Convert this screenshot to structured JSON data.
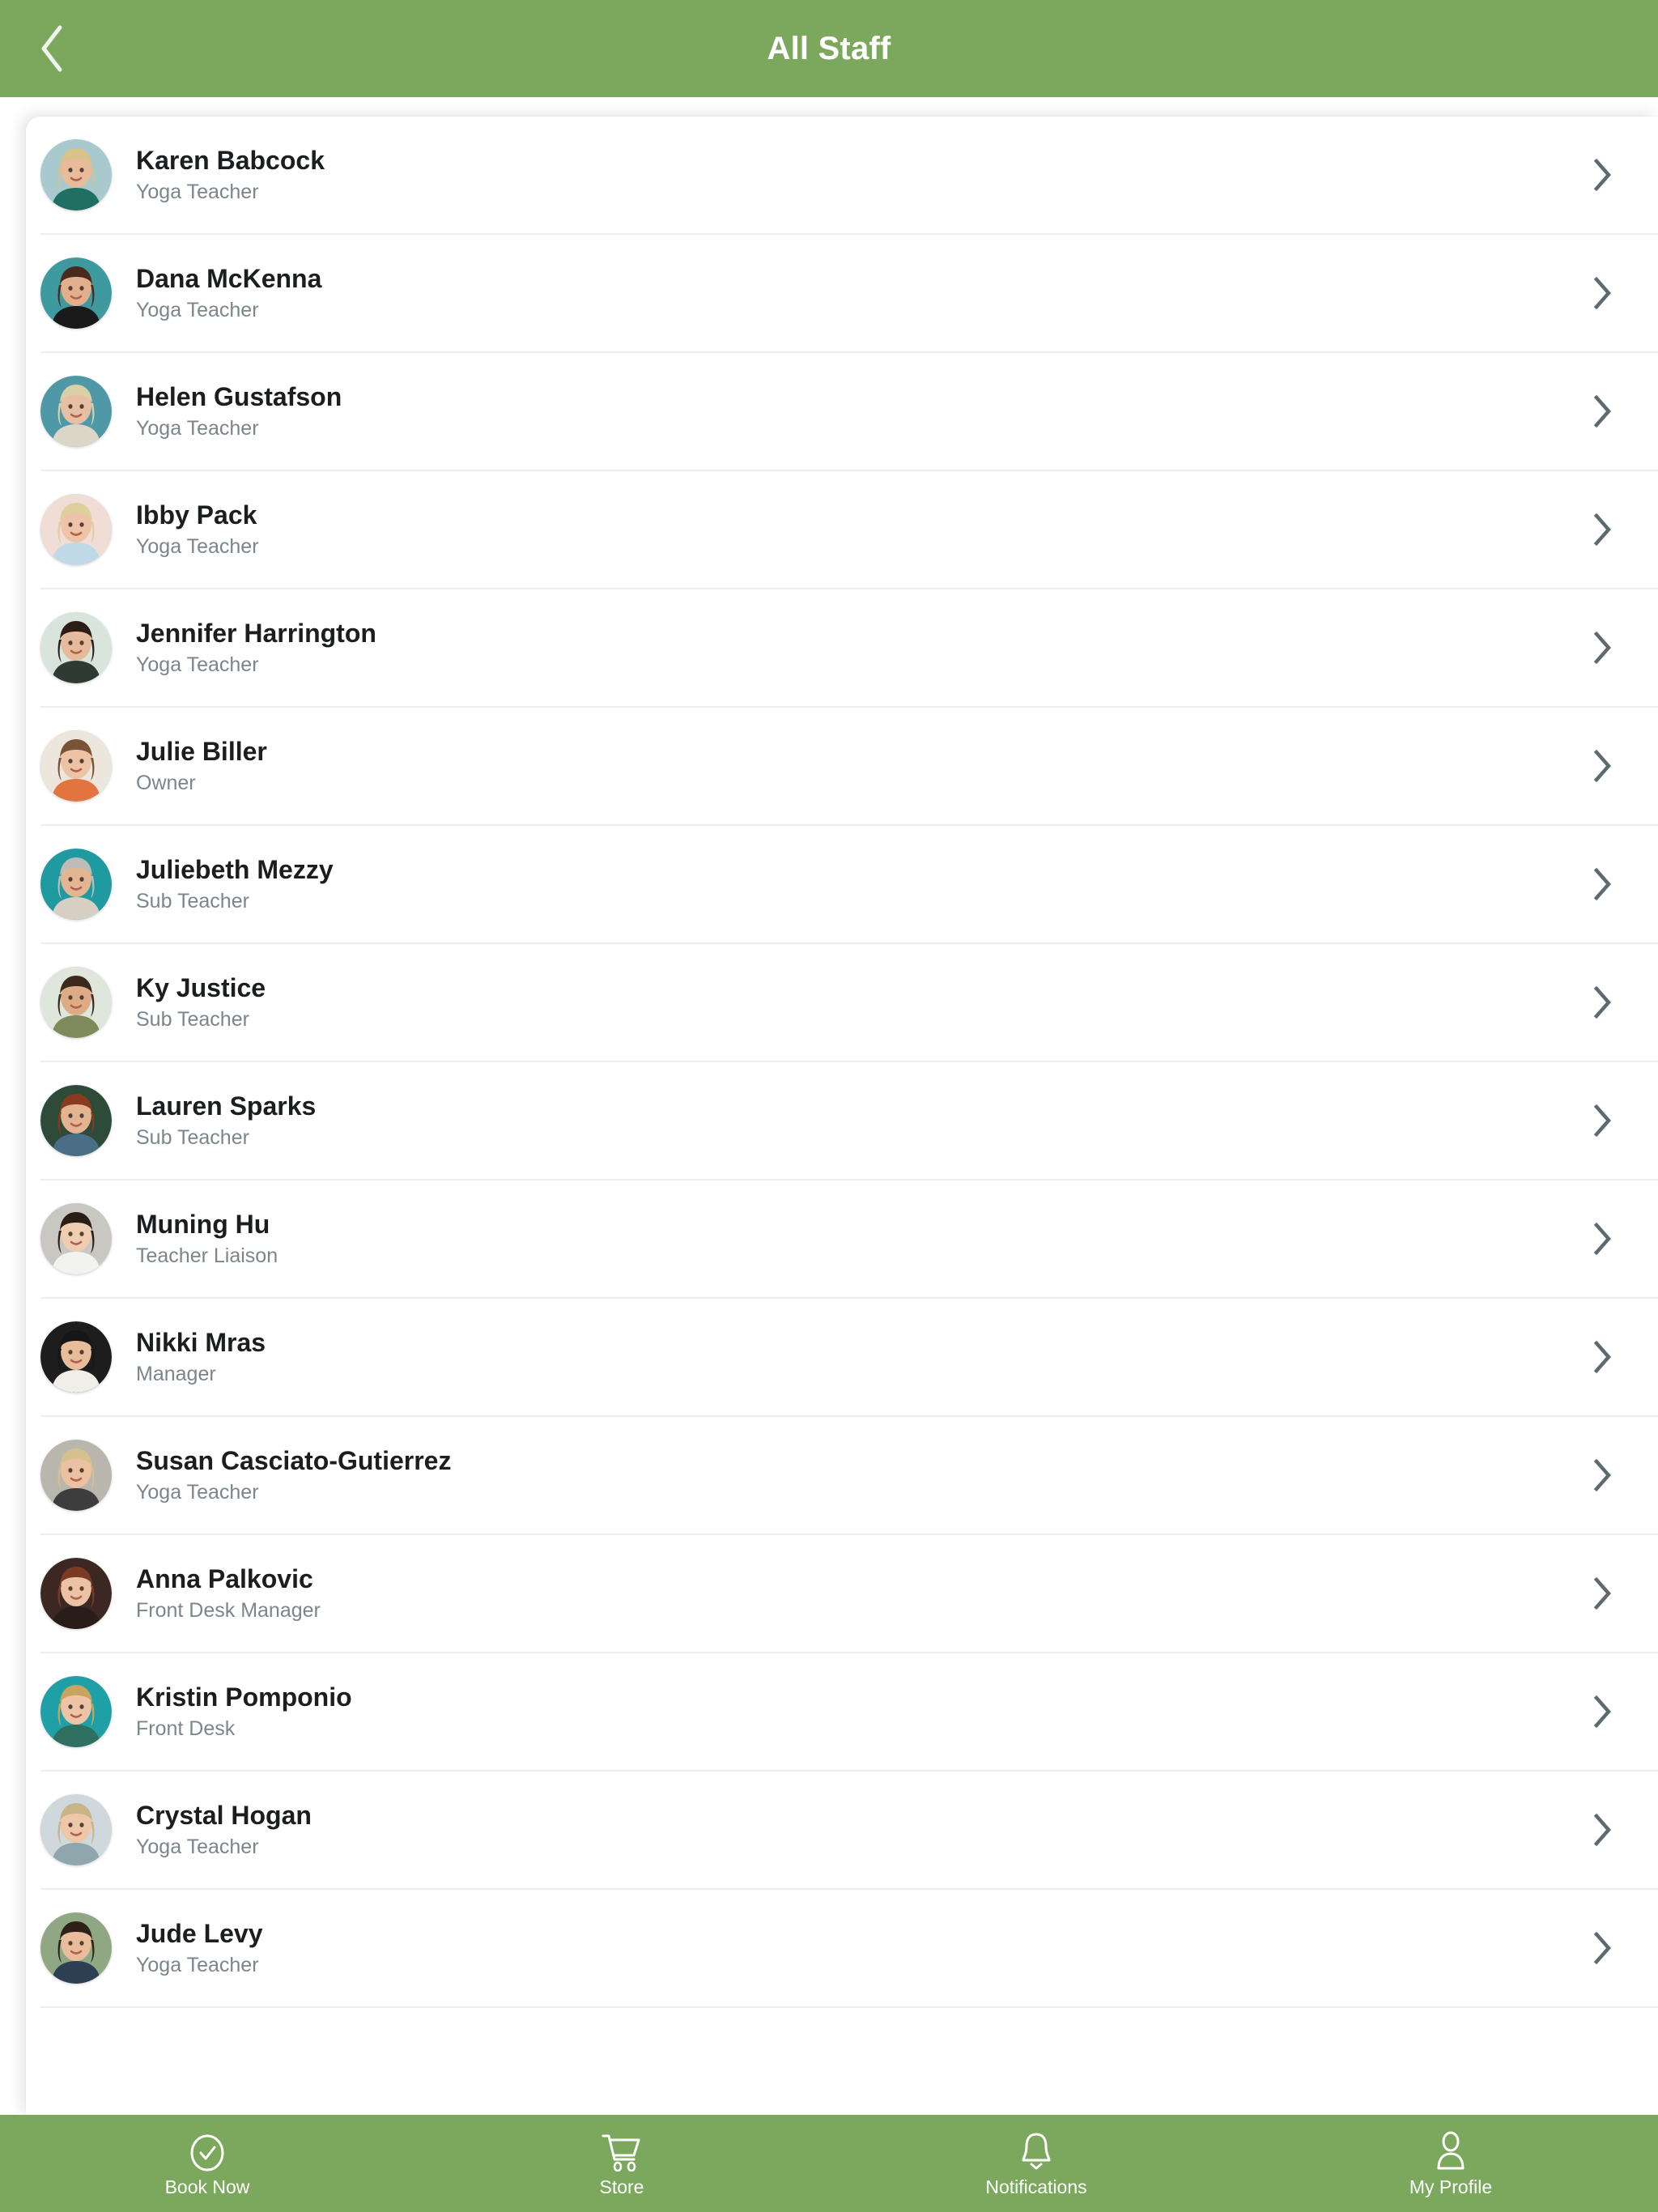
{
  "appbar": {
    "title": "All Staff",
    "back_icon": "chevron-left-icon",
    "background_color": "#7ba85d",
    "title_color": "#ffffff"
  },
  "colors": {
    "brand_green": "#7ba85d",
    "name_text": "#1b1d1f",
    "role_text": "#7b868c",
    "divider": "#eceded",
    "chevron": "#5d6a6f",
    "card_background": "#ffffff"
  },
  "list": {
    "row_chevron_icon": "chevron-right-icon",
    "items": [
      {
        "name": "Karen Babcock",
        "role": "Yoga Teacher",
        "avatar_icon": "avatar-photo",
        "avatar_bg": "#a8c9ce",
        "hair": "#d8c28a",
        "skin": "#e8bb9a",
        "clothes": "#1f6f63"
      },
      {
        "name": "Dana McKenna",
        "role": "Yoga Teacher",
        "avatar_icon": "avatar-photo",
        "avatar_bg": "#3f9aa0",
        "hair": "#4a2a1c",
        "skin": "#e3ae8c",
        "clothes": "#1a1a1a"
      },
      {
        "name": "Helen Gustafson",
        "role": "Yoga Teacher",
        "avatar_icon": "avatar-photo",
        "avatar_bg": "#4f98a8",
        "hair": "#d9cfa8",
        "skin": "#e7c0a4",
        "clothes": "#dcd6c8"
      },
      {
        "name": "Ibby Pack",
        "role": "Yoga Teacher",
        "avatar_icon": "avatar-photo",
        "avatar_bg": "#f0ddd6",
        "hair": "#e0cf9e",
        "skin": "#eec4a8",
        "clothes": "#bfd9e6"
      },
      {
        "name": "Jennifer Harrington",
        "role": "Yoga Teacher",
        "avatar_icon": "avatar-photo",
        "avatar_bg": "#d9e4dc",
        "hair": "#2c1d16",
        "skin": "#e6bb9c",
        "clothes": "#2f3a33"
      },
      {
        "name": "Julie Biller",
        "role": "Owner",
        "avatar_icon": "avatar-photo",
        "avatar_bg": "#ece6dd",
        "hair": "#7a5336",
        "skin": "#edc3a5",
        "clothes": "#e2743f"
      },
      {
        "name": "Juliebeth Mezzy",
        "role": "Sub Teacher",
        "avatar_icon": "avatar-photo",
        "avatar_bg": "#1e9aa0",
        "hair": "#bcbcb8",
        "skin": "#e3b693",
        "clothes": "#d8cfc4"
      },
      {
        "name": "Ky Justice",
        "role": "Sub Teacher",
        "avatar_icon": "avatar-photo",
        "avatar_bg": "#dfe6dc",
        "hair": "#3b2a1c",
        "skin": "#ddac87",
        "clothes": "#7e8a5b"
      },
      {
        "name": "Lauren Sparks",
        "role": "Sub Teacher",
        "avatar_icon": "avatar-photo",
        "avatar_bg": "#2e4a38",
        "hair": "#8a3a1e",
        "skin": "#e3b392",
        "clothes": "#4a6e86"
      },
      {
        "name": "Muning Hu",
        "role": "Teacher Liaison",
        "avatar_icon": "avatar-photo",
        "avatar_bg": "#c9c7c2",
        "hair": "#2a1d16",
        "skin": "#eecdb0",
        "clothes": "#f2f2f0"
      },
      {
        "name": "Nikki Mras",
        "role": "Manager",
        "avatar_icon": "avatar-photo",
        "avatar_bg": "#1d1d1d",
        "hair": "#161616",
        "skin": "#e8bd9a",
        "clothes": "#f0eee9"
      },
      {
        "name": "Susan Casciato-Gutierrez",
        "role": "Yoga Teacher",
        "avatar_icon": "avatar-photo",
        "avatar_bg": "#b9b6ae",
        "hair": "#d6c08e",
        "skin": "#ecc1a2",
        "clothes": "#3d3d3d"
      },
      {
        "name": "Anna Palkovic",
        "role": "Front Desk Manager",
        "avatar_icon": "avatar-photo",
        "avatar_bg": "#3c2722",
        "hair": "#7b3a22",
        "skin": "#ecc2a4",
        "clothes": "#2a1c18"
      },
      {
        "name": "Kristin Pomponio",
        "role": "Front Desk",
        "avatar_icon": "avatar-photo",
        "avatar_bg": "#1fa0a6",
        "hair": "#c9a45e",
        "skin": "#edc4a6",
        "clothes": "#2f6f5f"
      },
      {
        "name": "Crystal Hogan",
        "role": "Yoga Teacher",
        "avatar_icon": "avatar-photo",
        "avatar_bg": "#cfd9dd",
        "hair": "#c9b488",
        "skin": "#eec6a8",
        "clothes": "#8fa6ae"
      },
      {
        "name": "Jude Levy",
        "role": "Yoga Teacher",
        "avatar_icon": "avatar-photo",
        "avatar_bg": "#8fa883",
        "hair": "#2e2118",
        "skin": "#e9bd9c",
        "clothes": "#2d3f52"
      }
    ]
  },
  "tabbar": {
    "background_color": "#7ba85d",
    "tabs": [
      {
        "label": "Book Now",
        "icon": "check-circle-icon"
      },
      {
        "label": "Store",
        "icon": "shopping-cart-icon"
      },
      {
        "label": "Notifications",
        "icon": "bell-icon"
      },
      {
        "label": "My Profile",
        "icon": "person-icon"
      }
    ]
  }
}
